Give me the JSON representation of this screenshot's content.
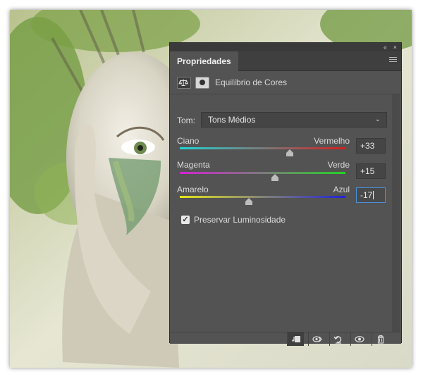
{
  "panel": {
    "title": "Propriedades",
    "adjustment_name": "Equilíbrio de Cores",
    "tone_label": "Tom:",
    "tone_value": "Tons Médios",
    "sliders": [
      {
        "left_label": "Ciano",
        "right_label": "Vermelho",
        "value": "+33",
        "value_number": 33,
        "gradient": [
          "#22d4d4",
          "#d41f1f"
        ]
      },
      {
        "left_label": "Magenta",
        "right_label": "Verde",
        "value": "+15",
        "value_number": 15,
        "gradient": [
          "#d422d4",
          "#22d422"
        ]
      },
      {
        "left_label": "Amarelo",
        "right_label": "Azul",
        "value": "-17",
        "value_number": -17,
        "gradient": [
          "#e6e61c",
          "#2222d4"
        ]
      }
    ],
    "preserve_label": "Preservar Luminosidade",
    "preserve_checked": true,
    "slider_range": [
      -100,
      100
    ],
    "footer_icons": [
      "clip-to-layer-icon",
      "view-previous-state-icon",
      "reset-icon",
      "visibility-icon",
      "trash-icon"
    ]
  }
}
